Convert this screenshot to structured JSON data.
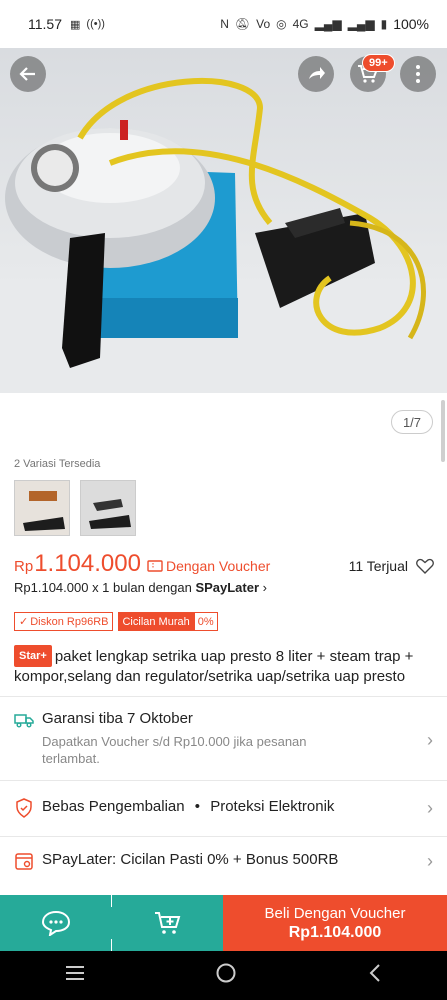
{
  "status_bar": {
    "time": "11.57",
    "battery": "100%",
    "network": "4G"
  },
  "hero": {
    "cart_badge": "99+",
    "page_counter": "1/7"
  },
  "variants": {
    "label": "2 Variasi Tersedia"
  },
  "price": {
    "currency": "Rp",
    "value": "1.104.000",
    "voucher_label": "Dengan Voucher",
    "sold": "11 Terjual"
  },
  "spaylater": {
    "prefix": "Rp1.104.000 x 1 bulan dengan ",
    "brand": "SPayLater"
  },
  "tags": {
    "discount": "Diskon Rp96RB",
    "installment_a": "Cicilan Murah",
    "installment_b": "0%"
  },
  "product": {
    "badge": "Star+",
    "title": "paket lengkap setrika uap presto 8 liter + steam trap + kompor,selang dan regulator/setrika uap/setrika uap presto"
  },
  "shipping": {
    "title": "Garansi tiba 7 Oktober",
    "subtitle": "Dapatkan Voucher s/d Rp10.000 jika pesanan terlambat."
  },
  "protection": {
    "item1": "Bebas Pengembalian",
    "dot": "•",
    "item2": "Proteksi Elektronik"
  },
  "spaylater_row": {
    "text": "SPayLater: Cicilan Pasti 0% + Bonus 500RB"
  },
  "bottom_bar": {
    "buy_label": "Beli Dengan Voucher",
    "buy_price": "Rp1.104.000"
  },
  "colors": {
    "accent": "#ee4d2d",
    "teal": "#26aa99"
  }
}
